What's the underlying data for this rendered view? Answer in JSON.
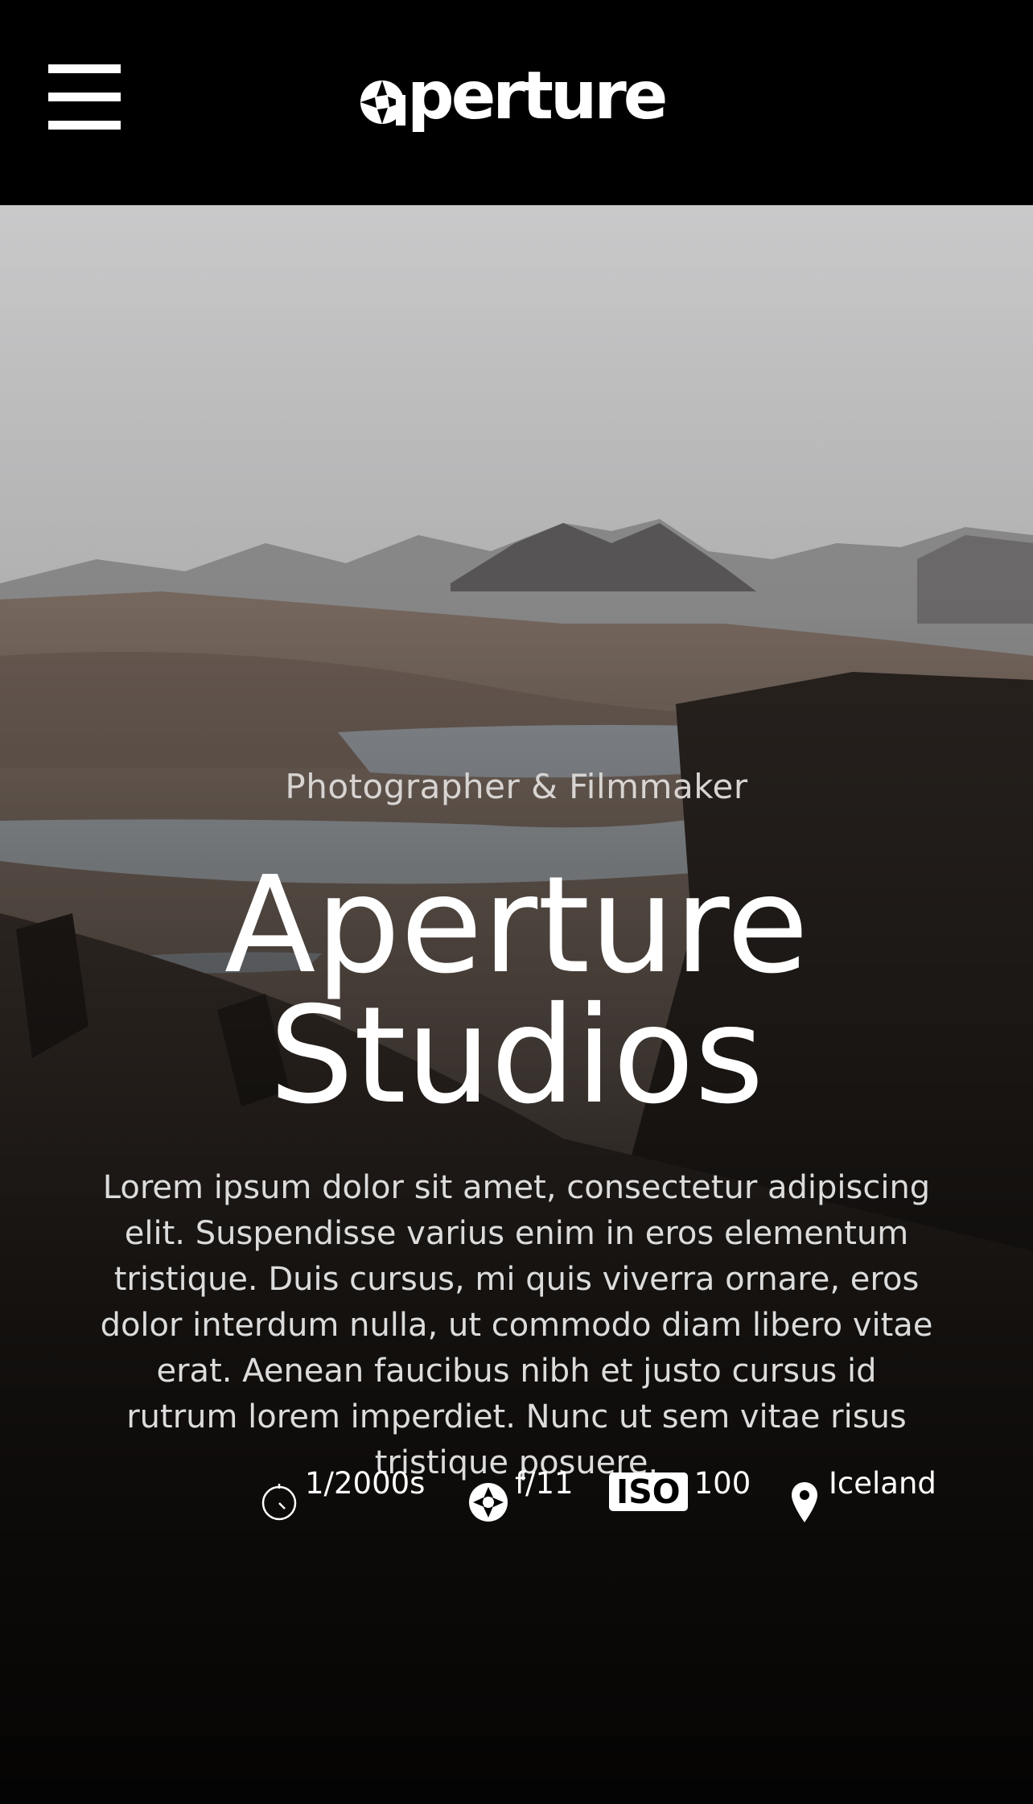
{
  "header": {
    "menu_icon": "hamburger-menu-icon",
    "logo_text": "perture"
  },
  "hero": {
    "eyebrow": "Photographer & Filmmaker",
    "title_line1": "Aperture",
    "title_line2": "Studios",
    "blurb": "Lorem ipsum dolor sit amet, consectetur adipiscing elit. Suspendisse varius enim in eros elementum tristique. Duis cursus, mi quis viverra ornare, eros dolor interdum nulla, ut commodo diam libero vitae erat. Aenean faucibus nibh et justo cursus id rutrum lorem imperdiet. Nunc ut sem vitae risus tristique posuere."
  },
  "specs": {
    "shutter": {
      "icon": "stopwatch-icon",
      "value": "1/2000s"
    },
    "aperture": {
      "icon": "aperture-icon",
      "value": "f/11"
    },
    "iso": {
      "badge": "ISO",
      "value": "100"
    },
    "location": {
      "icon": "map-pin-icon",
      "value": "Iceland"
    }
  },
  "colors": {
    "header_bg": "#000000",
    "text": "#ffffff"
  }
}
